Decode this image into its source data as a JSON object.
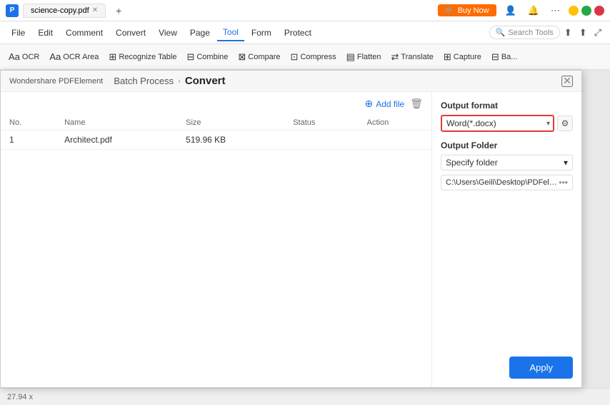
{
  "titleBar": {
    "appName": "Wondershare PDFElement",
    "tabLabel": "science-copy.pdf",
    "addTabLabel": "+",
    "buyNow": "Buy Now",
    "searchPlaceholder": "Search Tools"
  },
  "menuBar": {
    "items": [
      "File",
      "Edit",
      "Comment",
      "Convert",
      "View",
      "Page",
      "Tool",
      "Form",
      "Protect"
    ]
  },
  "toolbar": {
    "items": [
      {
        "label": "OCR",
        "icon": "Aa"
      },
      {
        "label": "OCR Area",
        "icon": "Aa"
      },
      {
        "label": "Recognize Table",
        "icon": "⊞"
      },
      {
        "label": "Combine",
        "icon": "⊟"
      },
      {
        "label": "Compare",
        "icon": "⊠"
      },
      {
        "label": "Compress",
        "icon": "⊡"
      },
      {
        "label": "Flatten",
        "icon": "▤"
      },
      {
        "label": "Translate",
        "icon": "⇄"
      },
      {
        "label": "Capture",
        "icon": "⊞"
      },
      {
        "label": "Ba...",
        "icon": "⊟"
      }
    ]
  },
  "modal": {
    "title": "Wondershare PDFElement",
    "breadcrumb": {
      "parent": "Batch Process",
      "current": "Convert"
    },
    "addFileLabel": "Add file",
    "table": {
      "headers": [
        "No.",
        "Name",
        "Size",
        "Status",
        "Action"
      ],
      "rows": [
        {
          "no": "1",
          "name": "Architect.pdf",
          "size": "519.96 KB",
          "status": "",
          "action": ""
        }
      ]
    },
    "rightPanel": {
      "outputFormatTitle": "Output format",
      "formatValue": "Word(*.docx)",
      "outputFolderTitle": "Output Folder",
      "folderOption": "Specify folder",
      "folderPath": "C:\\Users\\Geili\\Desktop\\PDFelement\\Cc"
    },
    "applyLabel": "Apply"
  },
  "statusBar": {
    "zoom": "27.94 x"
  }
}
